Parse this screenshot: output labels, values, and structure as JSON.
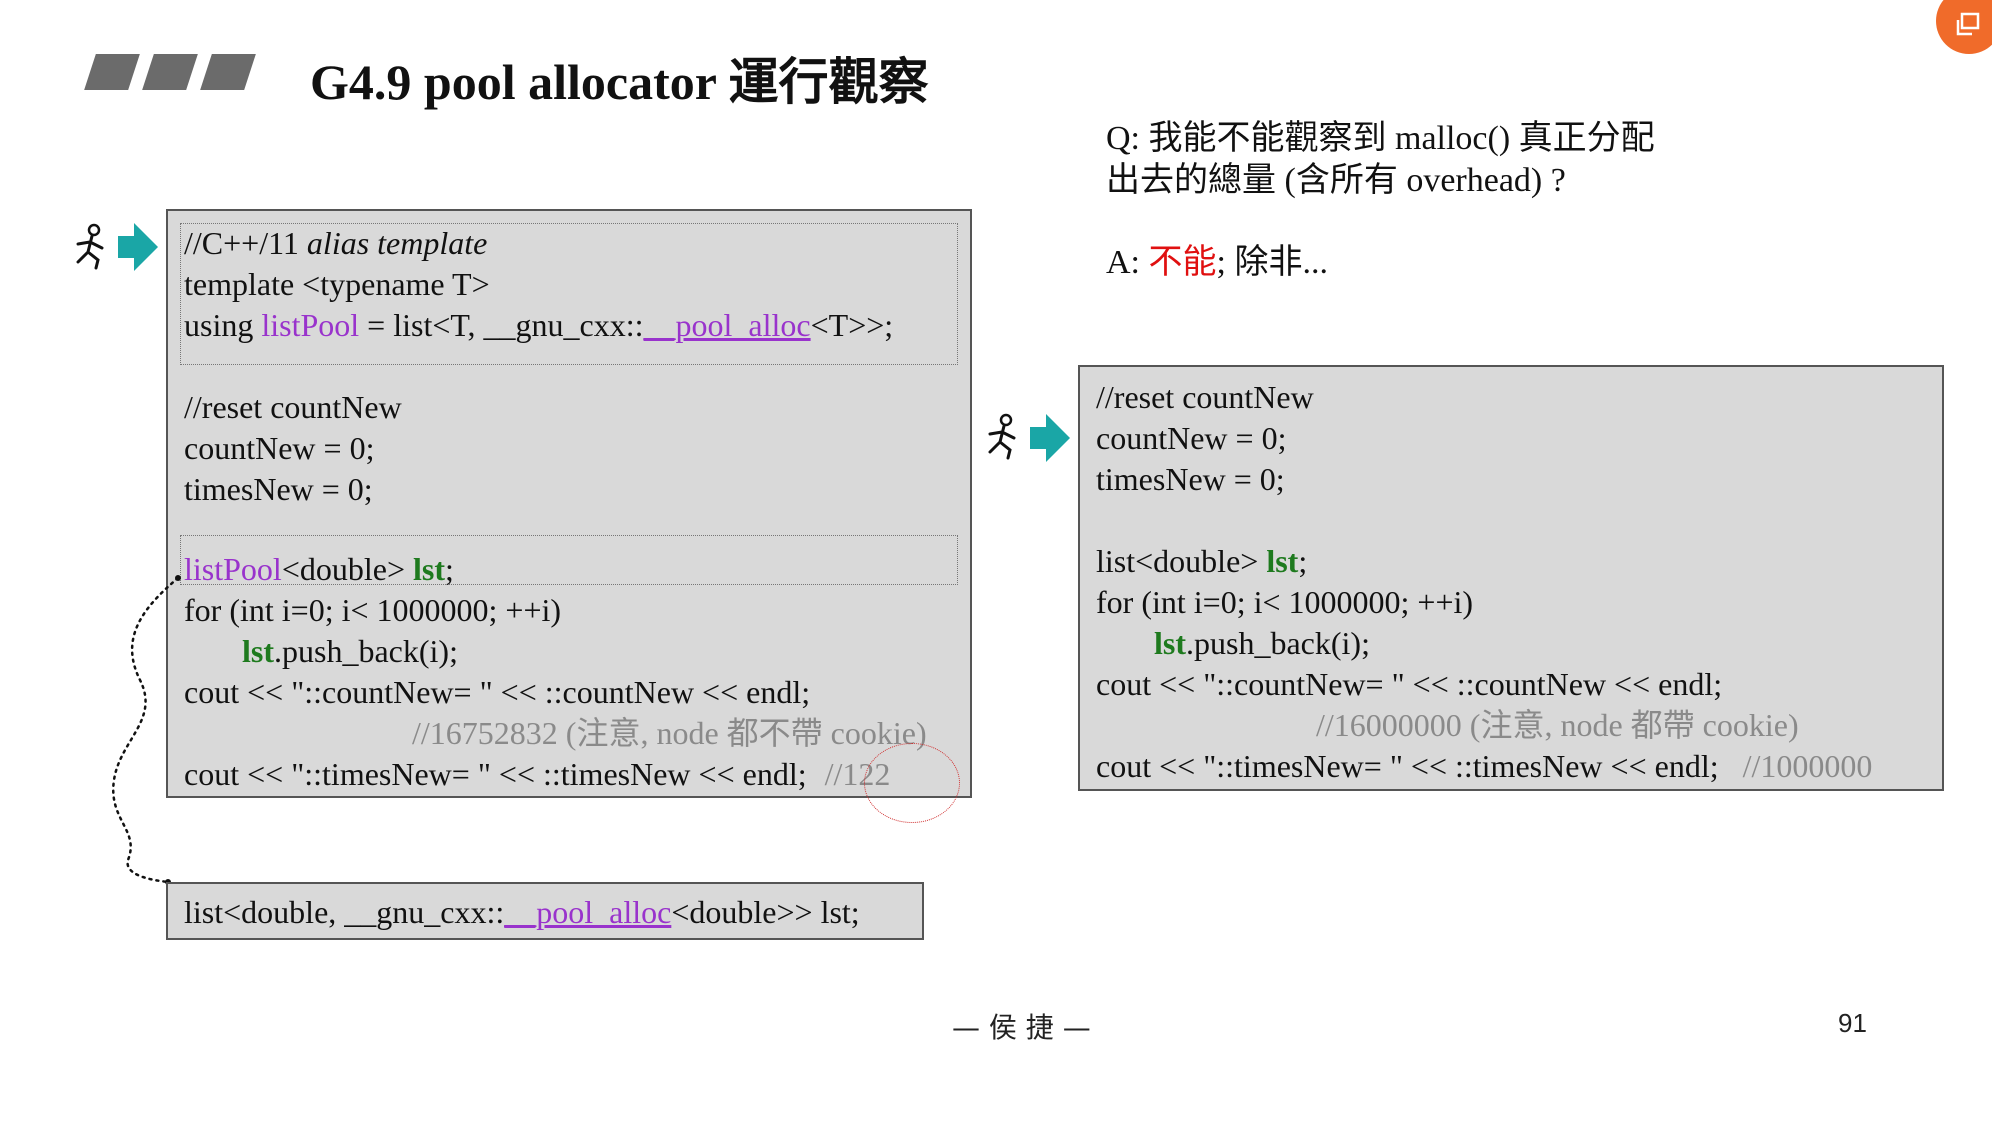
{
  "slide": {
    "title": "G4.9 pool allocator 運行觀察",
    "page_number": "91",
    "footer": "— 侯 捷 —"
  },
  "qa": {
    "question_line1": "Q: 我能不能觀察到 malloc() 真正分配",
    "question_line2": "出去的總量 (含所有 overhead) ?",
    "answer_prefix": "A: ",
    "answer_red": "不能",
    "answer_suffix": "; 除非..."
  },
  "left_code": {
    "l1_a": "//C++/11 ",
    "l1_b": "alias template",
    "l2": "template <typename T>",
    "l3_a": "using ",
    "l3_b": "listPool",
    "l3_c": " = list<T, __gnu_cxx::",
    "l3_d": "__pool_alloc",
    "l3_e": "<T>>;",
    "l4": "//reset countNew",
    "l5": "countNew = 0;",
    "l6": "timesNew = 0;",
    "l7_a": "listPool",
    "l7_b": "<double> ",
    "l7_c": "lst",
    "l7_d": ";",
    "l8": "for (int i=0; i< 1000000; ++i)",
    "l9_a": "lst",
    "l9_b": ".push_back(i);",
    "l10": "cout << \"::countNew= \" << ::countNew << endl;",
    "l11": "//16752832 (注意, node 都不帶 cookie)",
    "l12_a": "cout << \"::timesNew= \" << ::timesNew << endl;",
    "l12_b": "//122"
  },
  "bottom_code": {
    "a": "list<double, __gnu_cxx::",
    "b": "__pool_alloc",
    "c": "<double>> lst;"
  },
  "right_code": {
    "l1": "//reset countNew",
    "l2": "countNew = 0;",
    "l3": "timesNew = 0;",
    "l4_a": "list<double> ",
    "l4_b": "lst",
    "l4_c": ";",
    "l5": "for (int i=0; i< 1000000; ++i)",
    "l6_a": "lst",
    "l6_b": ".push_back(i);",
    "l7": "cout << \"::countNew= \" << ::countNew << endl;",
    "l8": "//16000000 (注意, node 都帶 cookie)",
    "l9_a": "cout << \"::timesNew= \" << ::timesNew << endl;",
    "l9_b": "//1000000"
  },
  "icons": {
    "runner": "running-man-icon",
    "arrow": "right-arrow-icon",
    "corner": "share-icon"
  },
  "colors": {
    "template_keyword": "#9933cc",
    "variable": "#1e7a1e",
    "answer_highlight": "#e01010",
    "arrow": "#1aa6a6",
    "corner_button": "#f06b2a"
  }
}
